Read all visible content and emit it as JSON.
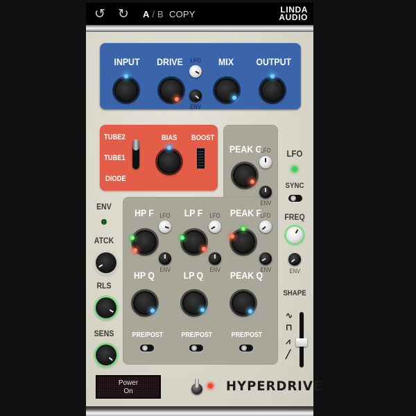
{
  "toolbar": {
    "undo_icon": "undo-icon",
    "redo_icon": "redo-icon",
    "ab_a": "A",
    "ab_sep": "/",
    "ab_b": "B",
    "copy": "COPY",
    "brand_line1": "LINDA",
    "brand_line2": "AUDIO"
  },
  "main": {
    "input": "INPUT",
    "drive": "DRIVE",
    "mix": "MIX",
    "output": "OUTPUT",
    "drive_lfo": "LFO",
    "drive_env": "ENV"
  },
  "tube": {
    "modes": [
      "TUBE2",
      "TUBE1",
      "DIODE"
    ],
    "bias": "BIAS",
    "boost": "BOOST"
  },
  "filters": {
    "peak_g": "PEAK G",
    "hp_f": "HP F",
    "lp_f": "LP F",
    "peak_f": "PEAK F",
    "hp_q": "HP Q",
    "lp_q": "LP Q",
    "peak_q": "PEAK Q",
    "lfo": "LFO",
    "env": "ENV",
    "pre_post": "PRE/POST"
  },
  "envelope": {
    "title": "ENV",
    "attack": "ATCK",
    "release": "RLS",
    "sens": "SENS"
  },
  "lfo": {
    "title": "LFO",
    "sync": "SYNC",
    "freq": "FREQ",
    "env": "ENV",
    "shape": "SHAPE",
    "shape_waves": [
      "∿",
      "⊓",
      "⩘",
      "╱"
    ]
  },
  "footer": {
    "power_line1": "Power",
    "power_line2": "On",
    "product_name": "HYPERDRIVE"
  },
  "colors": {
    "blue_panel": "#3a65aa",
    "red_panel": "#e45d48",
    "gray_panel": "#a9a79a",
    "faceplate": "#d9d7ca",
    "led_green": "#3cd44f",
    "led_red": "#ff3b2a"
  }
}
